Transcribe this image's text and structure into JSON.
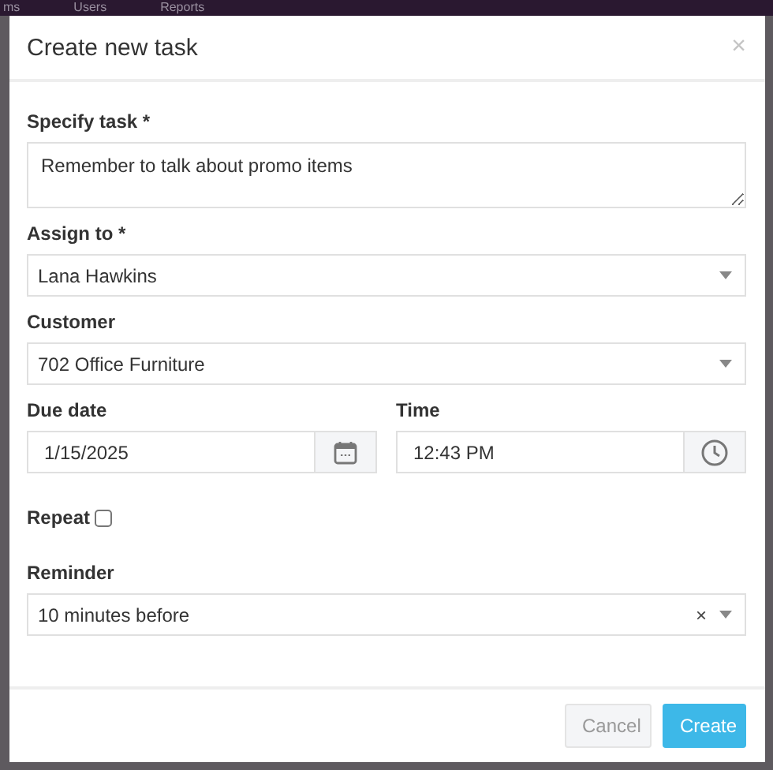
{
  "background_nav": [
    "ms",
    "Users",
    "Reports"
  ],
  "dialog": {
    "title": "Create new task",
    "close": "×"
  },
  "task": {
    "label": "Specify task *",
    "value": "Remember to talk about promo items"
  },
  "assign_to": {
    "label": "Assign to *",
    "value": "Lana Hawkins"
  },
  "customer": {
    "label": "Customer",
    "value": "702 Office Furniture"
  },
  "due_date": {
    "label": "Due date",
    "value": "1/15/2025"
  },
  "time": {
    "label": "Time",
    "value": "12:43 PM"
  },
  "repeat": {
    "label": "Repeat",
    "checked": false
  },
  "reminder": {
    "label": "Reminder",
    "value": "10 minutes before",
    "clear": "×"
  },
  "buttons": [
    {
      "label": "Cancel",
      "kind": "secondary"
    },
    {
      "label": "Create",
      "kind": "primary"
    }
  ]
}
